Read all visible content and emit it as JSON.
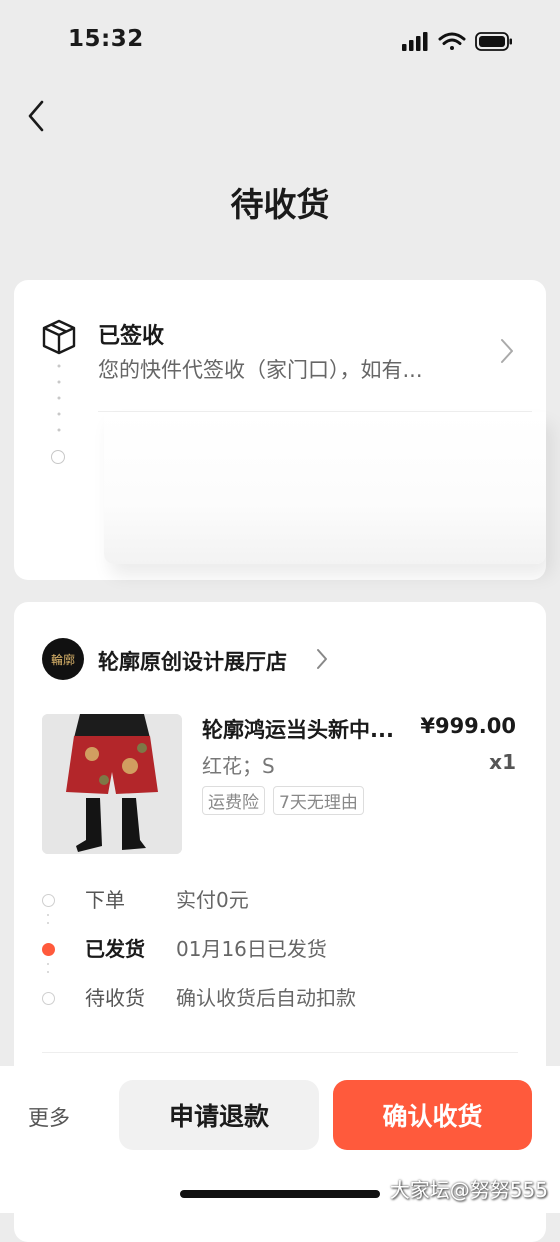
{
  "status_bar": {
    "time": "15:32"
  },
  "header": {
    "title": "待收货"
  },
  "tracking": {
    "title": "已签收",
    "description": "您的快件代签收（家门口），如有..."
  },
  "shop": {
    "logo_text": "輪廓",
    "name": "轮廓原创设计展厅店"
  },
  "product": {
    "name": "轮廓鸿运当头新中...",
    "price": "¥999.00",
    "variant": "红花；S",
    "quantity": "x1",
    "tags": [
      "运费险",
      "7天无理由"
    ]
  },
  "steps": [
    {
      "label": "下单",
      "detail": "实付0元",
      "active": false
    },
    {
      "label": "已发货",
      "detail": "01月16日已发货",
      "active": true
    },
    {
      "label": "待收货",
      "detail": "确认收货后自动扣款",
      "active": false
    }
  ],
  "actions": {
    "more": "更多",
    "refund": "申请退款",
    "confirm": "确认收货"
  },
  "watermark": "大家坛@努努555",
  "colors": {
    "accent": "#ff5a3c",
    "background": "#ececec"
  }
}
